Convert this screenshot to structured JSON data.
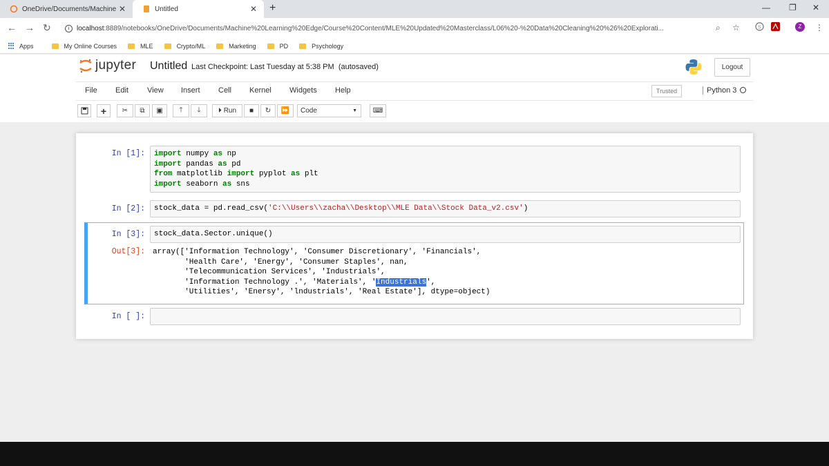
{
  "browser": {
    "tabs": [
      {
        "title": "OneDrive/Documents/Machine L",
        "active": false
      },
      {
        "title": "Untitled",
        "active": true
      }
    ],
    "url_host": "localhost",
    "url_path": ":8889/notebooks/OneDrive/Documents/Machine%20Learning%20Edge/Course%20Content/MLE%20Updated%20Masterclass/L06%20-%20Data%20Cleaning%20%26%20Explorati...",
    "profile_initial": "Z",
    "bookmarks": [
      "Apps",
      "My Online Courses",
      "MLE",
      "Crypto/ML",
      "Marketing",
      "PD",
      "Psychology"
    ]
  },
  "jupyter": {
    "logo_text": "jupyter",
    "notebook_name": "Untitled",
    "checkpoint": "Last Checkpoint: Last Tuesday at 5:38 PM",
    "autosave": "(autosaved)",
    "logout_label": "Logout",
    "menu": [
      "File",
      "Edit",
      "View",
      "Insert",
      "Cell",
      "Kernel",
      "Widgets",
      "Help"
    ],
    "trusted": "Trusted",
    "kernel_name": "Python 3",
    "run_label": "Run",
    "cell_type": "Code"
  },
  "cells": {
    "c1": {
      "prompt": "In [1]:"
    },
    "c2": {
      "prompt": "In [2]:"
    },
    "c3": {
      "prompt": "In [3]:",
      "out_prompt": "Out[3]:"
    },
    "c4": {
      "prompt": "In [ ]:"
    }
  },
  "colors": {
    "selected_cell_accent": "#42a5f5",
    "in_prompt": "#303f9f",
    "out_prompt": "#d84315"
  }
}
